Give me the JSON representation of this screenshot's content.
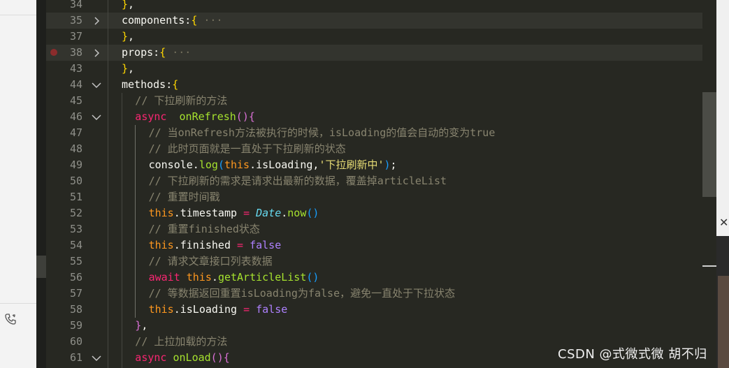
{
  "lines": [
    {
      "num": "34",
      "fold": "",
      "bp": false,
      "hl": false,
      "indent": 0,
      "parts": [
        {
          "t": "}",
          "c": "br"
        },
        {
          "t": ",",
          "c": ""
        }
      ]
    },
    {
      "num": "35",
      "fold": "closed",
      "bp": false,
      "hl": true,
      "indent": 0,
      "parts": [
        {
          "t": "components:",
          "c": ""
        },
        {
          "t": "{",
          "c": "br"
        },
        {
          "t": " ···",
          "c": "fold-ell"
        }
      ]
    },
    {
      "num": "37",
      "fold": "",
      "bp": false,
      "hl": false,
      "indent": 0,
      "parts": [
        {
          "t": "}",
          "c": "br"
        },
        {
          "t": ",",
          "c": ""
        }
      ]
    },
    {
      "num": "38",
      "fold": "closed",
      "bp": true,
      "hl": true,
      "indent": 0,
      "parts": [
        {
          "t": "props:",
          "c": ""
        },
        {
          "t": "{",
          "c": "br"
        },
        {
          "t": " ···",
          "c": "fold-ell"
        }
      ]
    },
    {
      "num": "43",
      "fold": "",
      "bp": false,
      "hl": false,
      "indent": 0,
      "parts": [
        {
          "t": "}",
          "c": "br"
        },
        {
          "t": ",",
          "c": ""
        }
      ]
    },
    {
      "num": "44",
      "fold": "open",
      "bp": false,
      "hl": false,
      "indent": 0,
      "parts": [
        {
          "t": "methods:",
          "c": ""
        },
        {
          "t": "{",
          "c": "br"
        }
      ]
    },
    {
      "num": "45",
      "fold": "",
      "bp": false,
      "hl": false,
      "indent": 1,
      "parts": [
        {
          "t": "// 下拉刷新的方法",
          "c": "cm"
        }
      ]
    },
    {
      "num": "46",
      "fold": "open",
      "bp": false,
      "hl": false,
      "indent": 1,
      "parts": [
        {
          "t": "async",
          "c": "kw"
        },
        {
          "t": "  ",
          "c": ""
        },
        {
          "t": "onRefresh",
          "c": "fn"
        },
        {
          "t": "()",
          "c": "br2"
        },
        {
          "t": "{",
          "c": "br2"
        }
      ]
    },
    {
      "num": "47",
      "fold": "",
      "bp": false,
      "hl": false,
      "indent": 2,
      "parts": [
        {
          "t": "// 当onRefresh方法被执行的时候，isLoading的值会自动的变为true",
          "c": "cm"
        }
      ]
    },
    {
      "num": "48",
      "fold": "",
      "bp": false,
      "hl": false,
      "indent": 2,
      "parts": [
        {
          "t": "// 此时页面就是一直处于下拉刷新的状态",
          "c": "cm"
        }
      ]
    },
    {
      "num": "49",
      "fold": "",
      "bp": false,
      "hl": false,
      "indent": 2,
      "parts": [
        {
          "t": "console.",
          "c": ""
        },
        {
          "t": "log",
          "c": "fn"
        },
        {
          "t": "(",
          "c": "br3"
        },
        {
          "t": "this",
          "c": "th"
        },
        {
          "t": ".isLoading,",
          "c": ""
        },
        {
          "t": "'下拉刷新中'",
          "c": "str"
        },
        {
          "t": ")",
          "c": "br3"
        },
        {
          "t": ";",
          "c": ""
        }
      ]
    },
    {
      "num": "50",
      "fold": "",
      "bp": false,
      "hl": false,
      "indent": 2,
      "parts": [
        {
          "t": "// 下拉刷新的需求是请求出最新的数据，覆盖掉articleList",
          "c": "cm"
        }
      ]
    },
    {
      "num": "51",
      "fold": "",
      "bp": false,
      "hl": false,
      "indent": 2,
      "parts": [
        {
          "t": "// 重置时间戳",
          "c": "cm"
        }
      ]
    },
    {
      "num": "52",
      "fold": "",
      "bp": false,
      "hl": false,
      "indent": 2,
      "parts": [
        {
          "t": "this",
          "c": "th"
        },
        {
          "t": ".timestamp ",
          "c": ""
        },
        {
          "t": "=",
          "c": "op"
        },
        {
          "t": " ",
          "c": ""
        },
        {
          "t": "Date",
          "c": "cl"
        },
        {
          "t": ".",
          "c": ""
        },
        {
          "t": "now",
          "c": "fn"
        },
        {
          "t": "()",
          "c": "br3"
        }
      ]
    },
    {
      "num": "53",
      "fold": "",
      "bp": false,
      "hl": false,
      "indent": 2,
      "parts": [
        {
          "t": "// 重置finished状态",
          "c": "cm"
        }
      ]
    },
    {
      "num": "54",
      "fold": "",
      "bp": false,
      "hl": false,
      "indent": 2,
      "parts": [
        {
          "t": "this",
          "c": "th"
        },
        {
          "t": ".finished ",
          "c": ""
        },
        {
          "t": "=",
          "c": "op"
        },
        {
          "t": " ",
          "c": ""
        },
        {
          "t": "false",
          "c": "bool"
        }
      ]
    },
    {
      "num": "55",
      "fold": "",
      "bp": false,
      "hl": false,
      "indent": 2,
      "parts": [
        {
          "t": "// 请求文章接口列表数据",
          "c": "cm"
        }
      ]
    },
    {
      "num": "56",
      "fold": "",
      "bp": false,
      "hl": false,
      "indent": 2,
      "parts": [
        {
          "t": "await",
          "c": "kw"
        },
        {
          "t": " ",
          "c": ""
        },
        {
          "t": "this",
          "c": "th"
        },
        {
          "t": ".",
          "c": ""
        },
        {
          "t": "getArticleList",
          "c": "fn"
        },
        {
          "t": "()",
          "c": "br3"
        }
      ]
    },
    {
      "num": "57",
      "fold": "",
      "bp": false,
      "hl": false,
      "indent": 2,
      "parts": [
        {
          "t": "// 等数据返回重置isLoading为false，避免一直处于下拉状态",
          "c": "cm"
        }
      ]
    },
    {
      "num": "58",
      "fold": "",
      "bp": false,
      "hl": false,
      "indent": 2,
      "parts": [
        {
          "t": "this",
          "c": "th"
        },
        {
          "t": ".isLoading ",
          "c": ""
        },
        {
          "t": "=",
          "c": "op"
        },
        {
          "t": " ",
          "c": ""
        },
        {
          "t": "false",
          "c": "bool"
        }
      ]
    },
    {
      "num": "59",
      "fold": "",
      "bp": false,
      "hl": false,
      "indent": 1,
      "parts": [
        {
          "t": "}",
          "c": "br2"
        },
        {
          "t": ",",
          "c": ""
        }
      ]
    },
    {
      "num": "60",
      "fold": "",
      "bp": false,
      "hl": false,
      "indent": 1,
      "parts": [
        {
          "t": "// 上拉加载的方法",
          "c": "cm"
        }
      ]
    },
    {
      "num": "61",
      "fold": "open",
      "bp": false,
      "hl": false,
      "indent": 1,
      "parts": [
        {
          "t": "async",
          "c": "kw"
        },
        {
          "t": " ",
          "c": ""
        },
        {
          "t": "onLoad",
          "c": "fn"
        },
        {
          "t": "()",
          "c": "br2"
        },
        {
          "t": "{",
          "c": "br2"
        }
      ]
    }
  ],
  "watermark": "CSDN @式微式微   胡不归",
  "right_panel": {
    "close_glyph": "✕"
  },
  "icons": {
    "fold_closed": "chevron-right-icon",
    "fold_open": "chevron-down-icon",
    "phone": "phone-icon"
  }
}
